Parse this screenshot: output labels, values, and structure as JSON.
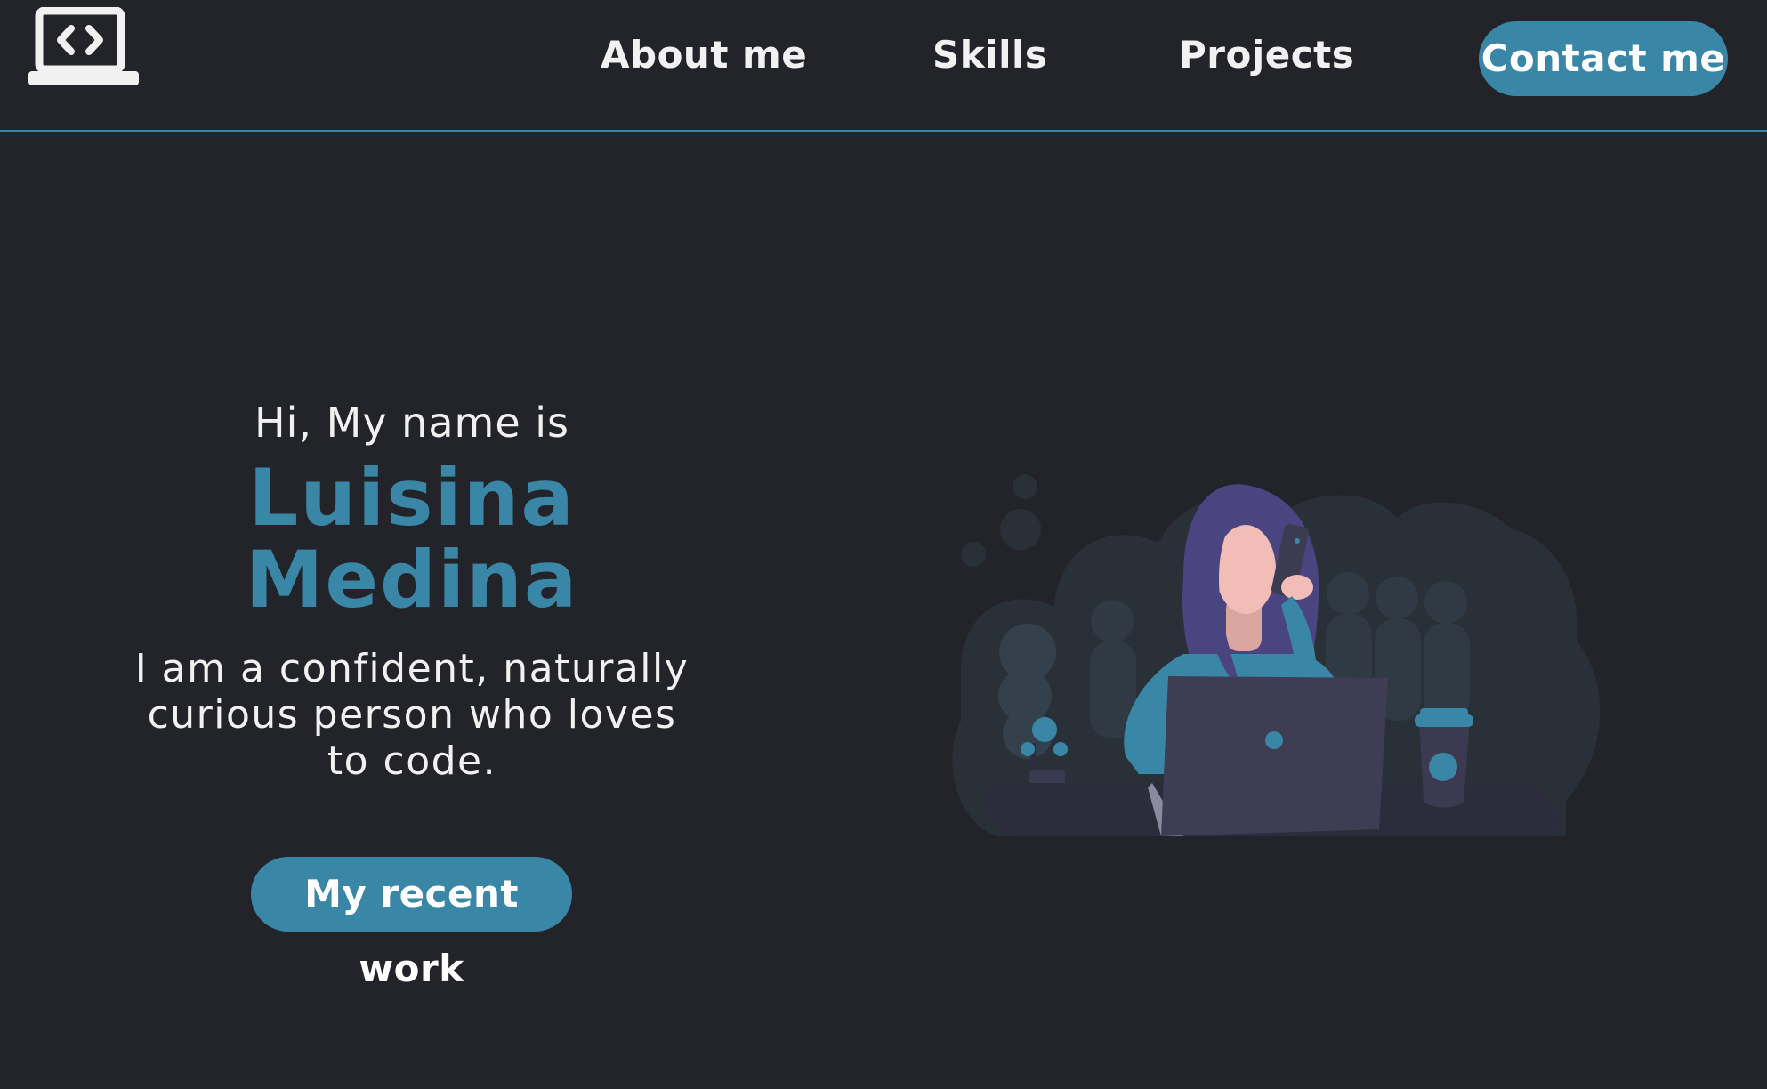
{
  "header": {
    "logo_icon": "laptop-code-icon",
    "nav": {
      "about": "About me",
      "skills": "Skills",
      "projects": "Projects"
    },
    "contact_label": "Contact me"
  },
  "hero": {
    "greeting": "Hi, My name is",
    "name_first": "Luisina",
    "name_last": "Medina",
    "description": "I am a confident, naturally curious person who loves to code.",
    "cta_label": "My recent work",
    "illustration": "woman-on-phone-with-laptop-illustration"
  },
  "colors": {
    "background": "#23242a",
    "accent": "#3a86a6",
    "text": "#f1f1f1"
  }
}
